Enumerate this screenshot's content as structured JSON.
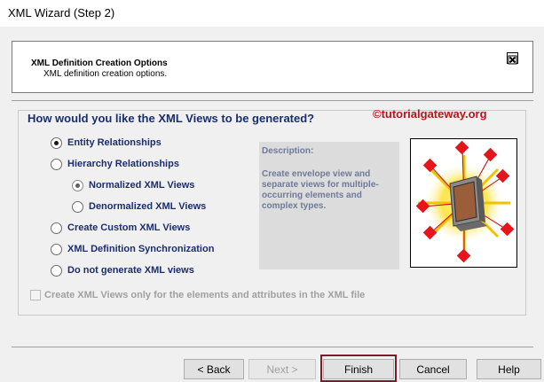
{
  "window": {
    "title": "XML Wizard (Step 2)"
  },
  "header": {
    "title": "XML Definition Creation Options",
    "subtitle": "XML definition creation options."
  },
  "main": {
    "question": "How would you like the XML Views to be generated?",
    "watermark": "©tutorialgateway.org",
    "options": [
      {
        "label": "Entity Relationships",
        "checked": true
      },
      {
        "label": "Hierarchy Relationships",
        "checked": false
      },
      {
        "label": "Normalized XML Views",
        "checked": true
      },
      {
        "label": "Denormalized XML Views",
        "checked": false
      },
      {
        "label": "Create Custom XML Views",
        "checked": false
      },
      {
        "label": "XML Definition Synchronization",
        "checked": false
      },
      {
        "label": "Do not generate XML views",
        "checked": false
      }
    ],
    "description": {
      "title": "Description:",
      "text": "Create envelope view and separate views for multiple-occurring elements and complex types."
    },
    "checkbox_label": "Create XML Views only for the elements and attributes in the XML file"
  },
  "buttons": {
    "back": "< Back",
    "next": "Next >",
    "finish": "Finish",
    "cancel": "Cancel",
    "help": "Help"
  },
  "colors": {
    "accent_text": "#1a2e6e",
    "watermark": "#b01a1a",
    "finish_highlight": "#7a1a2a",
    "diamond": "#e8141c"
  },
  "icons": {
    "header": "close-box-icon",
    "illustration": "xml-views-monitor-illustration"
  }
}
